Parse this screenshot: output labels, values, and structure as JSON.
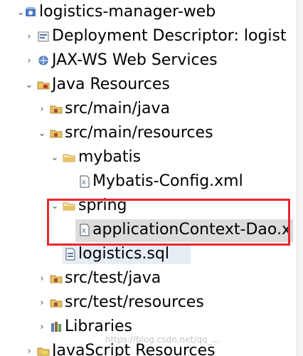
{
  "tree": {
    "items": [
      {
        "label": "logistics-manager-web",
        "expanded": true,
        "icon": "web-project-icon"
      },
      {
        "label": "Deployment Descriptor: logist",
        "expanded": false,
        "icon": "deployment-descriptor-icon"
      },
      {
        "label": "JAX-WS Web Services",
        "expanded": false,
        "icon": "web-services-icon"
      },
      {
        "label": "Java Resources",
        "expanded": true,
        "icon": "java-resources-icon"
      },
      {
        "label": "src/main/java",
        "expanded": false,
        "icon": "package-folder-icon"
      },
      {
        "label": "src/main/resources",
        "expanded": true,
        "icon": "package-folder-icon"
      },
      {
        "label": "mybatis",
        "expanded": true,
        "icon": "folder-icon"
      },
      {
        "label": "Mybatis-Config.xml",
        "icon": "xml-file-icon"
      },
      {
        "label": "spring",
        "expanded": true,
        "icon": "folder-icon"
      },
      {
        "label": "applicationContext-Dao.x",
        "icon": "xml-file-icon",
        "selected": true
      },
      {
        "label": "logistics.sql",
        "icon": "sql-file-icon"
      },
      {
        "label": "src/test/java",
        "expanded": false,
        "icon": "package-folder-icon"
      },
      {
        "label": "src/test/resources",
        "expanded": false,
        "icon": "package-folder-icon"
      },
      {
        "label": "Libraries",
        "expanded": false,
        "icon": "libraries-icon"
      },
      {
        "label": "JavaScript Resources",
        "expanded": false,
        "icon": "javascript-resources-icon"
      }
    ]
  },
  "watermark": "https://blog.csdn.net/qq_...",
  "colors": {
    "highlight_box": "#e8272e",
    "selection": "#dcdcdc",
    "folder": "#e8c26a"
  }
}
